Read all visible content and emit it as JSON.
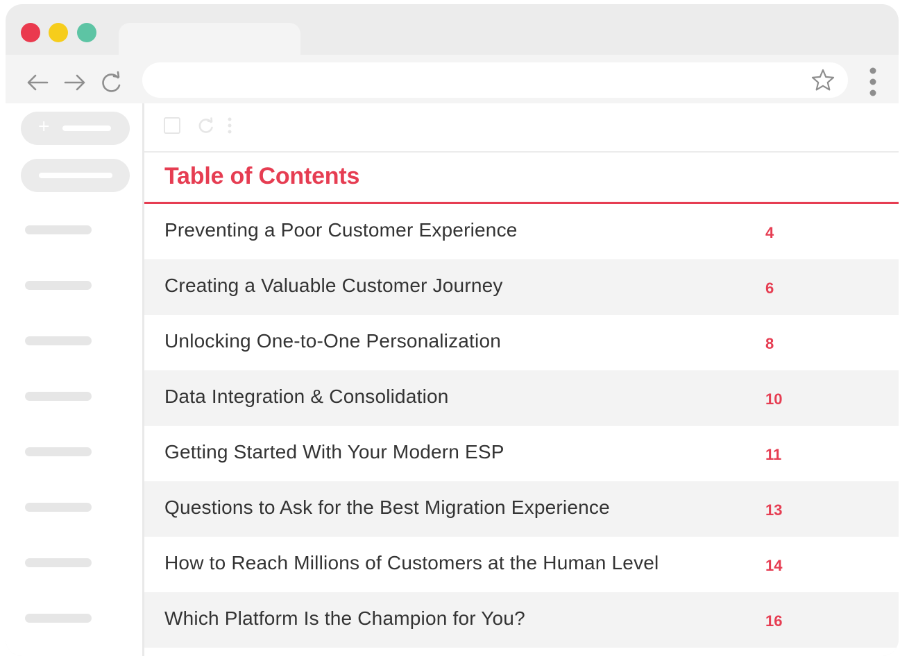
{
  "browser": {
    "controls": {
      "close_color": "#ea3a4e",
      "minimize_color": "#f6cd1c",
      "maximize_color": "#5dc4a4"
    },
    "nav_icons": [
      "back-arrow-icon",
      "forward-arrow-icon",
      "reload-icon"
    ],
    "address_bar_value": "",
    "bookmark_icon": "star-outline-icon",
    "menu_icon": "vertical-dots-icon"
  },
  "toc": {
    "title": "Table of Contents",
    "accent_color": "#e63d52",
    "entries": [
      {
        "label": "Preventing a Poor Customer Experience",
        "page": "4"
      },
      {
        "label": "Creating a Valuable Customer Journey",
        "page": "6"
      },
      {
        "label": "Unlocking One-to-One Personalization",
        "page": "8"
      },
      {
        "label": "Data Integration & Consolidation",
        "page": "10"
      },
      {
        "label": "Getting Started With Your Modern ESP",
        "page": "11"
      },
      {
        "label": "Questions to Ask for the Best Migration Experience",
        "page": "13"
      },
      {
        "label": "How to Reach Millions of Customers at the Human Level",
        "page": "14"
      },
      {
        "label": "Which Platform Is the Champion for You?",
        "page": "16"
      }
    ]
  }
}
